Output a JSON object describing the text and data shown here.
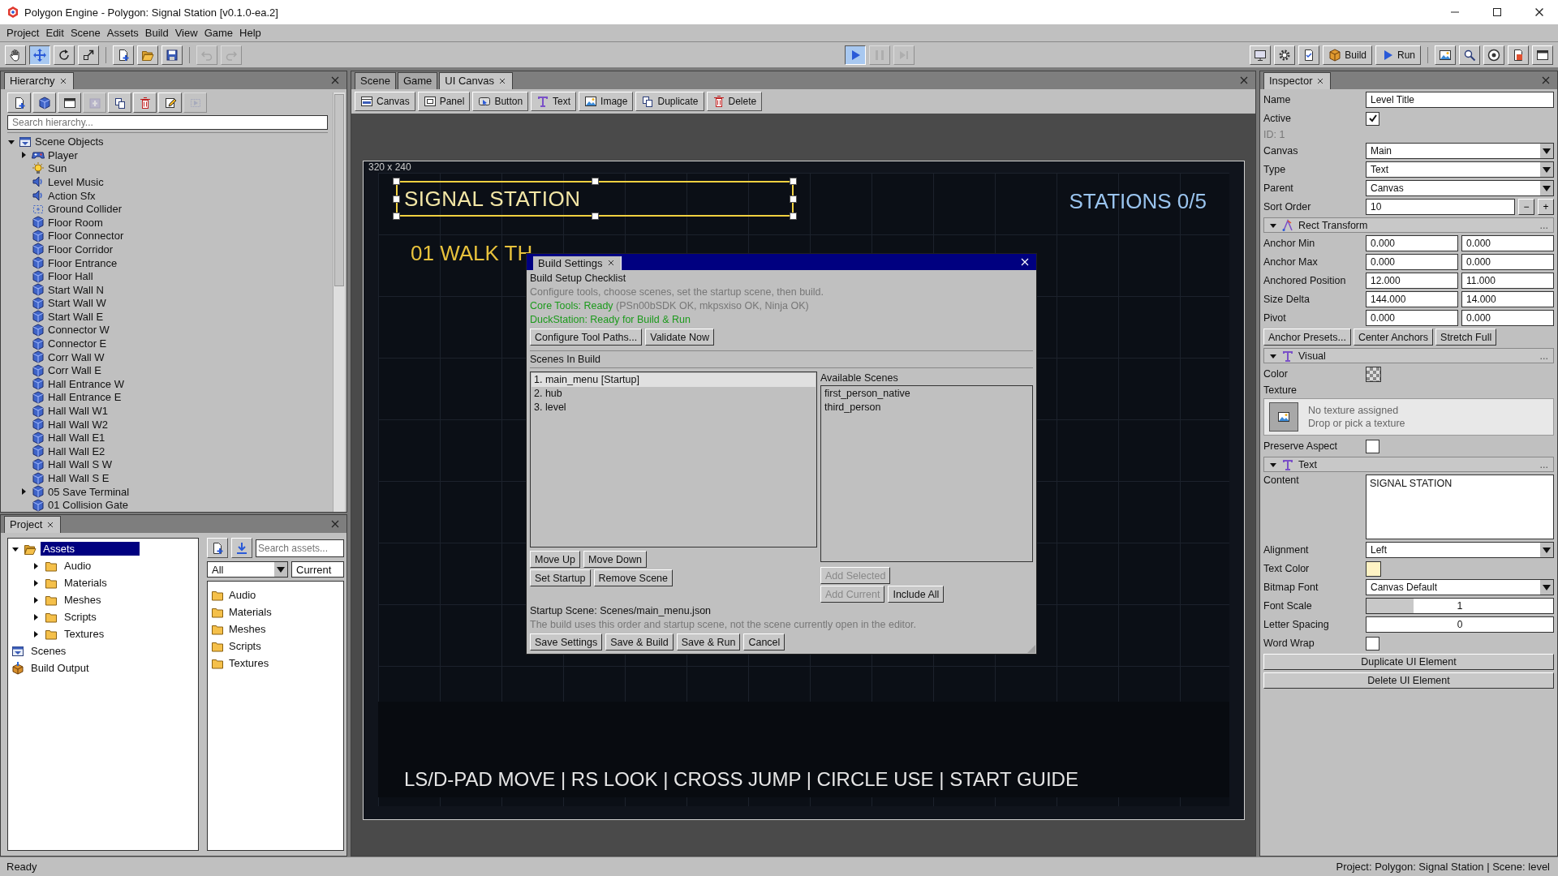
{
  "window": {
    "title": "Polygon Engine - Polygon: Signal Station [v0.1.0-ea.2]"
  },
  "menu": [
    "Project",
    "Edit",
    "Scene",
    "Assets",
    "Build",
    "View",
    "Game",
    "Help"
  ],
  "toolbar": {
    "left": [
      {
        "kind": "hand",
        "pressed": false,
        "disabled": false
      },
      {
        "kind": "move",
        "pressed": true,
        "disabled": false
      },
      {
        "kind": "rotate",
        "pressed": false,
        "disabled": false
      },
      {
        "kind": "scale",
        "pressed": false,
        "disabled": false
      },
      {
        "kind": "sep"
      },
      {
        "kind": "newdoc",
        "pressed": false,
        "disabled": false
      },
      {
        "kind": "open",
        "pressed": false,
        "disabled": false
      },
      {
        "kind": "save",
        "pressed": false,
        "disabled": false
      },
      {
        "kind": "sep"
      },
      {
        "kind": "undo",
        "pressed": false,
        "disabled": true
      },
      {
        "kind": "redo",
        "pressed": false,
        "disabled": true
      }
    ],
    "center": [
      {
        "kind": "play",
        "pressed": true,
        "disabled": false
      },
      {
        "kind": "pause",
        "pressed": false,
        "disabled": true
      },
      {
        "kind": "step",
        "pressed": false,
        "disabled": true
      }
    ],
    "right": [
      {
        "kind": "monitor",
        "pressed": false
      },
      {
        "kind": "gear",
        "pressed": false
      },
      {
        "kind": "checkdoc",
        "pressed": false
      },
      {
        "kind": "box",
        "label": "Build",
        "pressed": false
      },
      {
        "kind": "play",
        "label": "Run",
        "pressed": false
      },
      {
        "kind": "sep"
      },
      {
        "kind": "image",
        "pressed": false
      },
      {
        "kind": "search",
        "pressed": false
      },
      {
        "kind": "ring",
        "pressed": false
      },
      {
        "kind": "report",
        "pressed": false
      },
      {
        "kind": "window",
        "pressed": false
      }
    ]
  },
  "hierarchy": {
    "title": "Hierarchy",
    "tools": [
      {
        "kind": "newdoc",
        "disabled": false
      },
      {
        "kind": "cube",
        "disabled": false
      },
      {
        "kind": "window",
        "disabled": false
      },
      {
        "kind": "plusbox",
        "disabled": true
      },
      {
        "kind": "copy",
        "disabled": false
      },
      {
        "kind": "trash",
        "disabled": false
      },
      {
        "kind": "pencil",
        "disabled": false
      },
      {
        "kind": "prefab",
        "disabled": true
      }
    ],
    "search": {
      "placeholder": "Search hierarchy..."
    },
    "tree": [
      {
        "label": "Scene Objects",
        "kind": "scene",
        "expanded": true,
        "children": [
          {
            "label": "Player",
            "kind": "character",
            "expanded": false
          },
          {
            "label": "Sun",
            "kind": "light"
          },
          {
            "label": "Level Music",
            "kind": "audio"
          },
          {
            "label": "Action Sfx",
            "kind": "audio"
          },
          {
            "label": "Ground Collider",
            "kind": "collider"
          },
          {
            "label": "Floor Room",
            "kind": "cube"
          },
          {
            "label": "Floor Connector",
            "kind": "cube"
          },
          {
            "label": "Floor Corridor",
            "kind": "cube"
          },
          {
            "label": "Floor Entrance",
            "kind": "cube"
          },
          {
            "label": "Floor Hall",
            "kind": "cube"
          },
          {
            "label": "Start Wall N",
            "kind": "cube"
          },
          {
            "label": "Start Wall W",
            "kind": "cube"
          },
          {
            "label": "Start Wall E",
            "kind": "cube"
          },
          {
            "label": "Connector W",
            "kind": "cube"
          },
          {
            "label": "Connector E",
            "kind": "cube"
          },
          {
            "label": "Corr Wall W",
            "kind": "cube"
          },
          {
            "label": "Corr Wall E",
            "kind": "cube"
          },
          {
            "label": "Hall Entrance W",
            "kind": "cube"
          },
          {
            "label": "Hall Entrance E",
            "kind": "cube"
          },
          {
            "label": "Hall Wall W1",
            "kind": "cube"
          },
          {
            "label": "Hall Wall W2",
            "kind": "cube"
          },
          {
            "label": "Hall Wall E1",
            "kind": "cube"
          },
          {
            "label": "Hall Wall E2",
            "kind": "cube"
          },
          {
            "label": "Hall Wall S W",
            "kind": "cube"
          },
          {
            "label": "Hall Wall S E",
            "kind": "cube"
          },
          {
            "label": "05 Save Terminal",
            "kind": "cube",
            "expanded": false
          },
          {
            "label": "01 Collision Gate",
            "kind": "cube"
          }
        ]
      }
    ]
  },
  "project": {
    "title": "Project",
    "tree": [
      {
        "label": "Assets",
        "kind": "folder",
        "selected": true,
        "expanded": true,
        "children": [
          {
            "label": "Audio",
            "kind": "folder",
            "selected": false,
            "expanded": false
          },
          {
            "label": "Materials",
            "kind": "folder",
            "selected": false,
            "expanded": false
          },
          {
            "label": "Meshes",
            "kind": "folder",
            "selected": false,
            "expanded": false
          },
          {
            "label": "Scripts",
            "kind": "folder",
            "selected": false,
            "expanded": false
          },
          {
            "label": "Textures",
            "kind": "folder",
            "selected": false,
            "expanded": false
          }
        ]
      },
      {
        "label": "Scenes",
        "kind": "scene",
        "selected": false
      },
      {
        "label": "Build Output",
        "kind": "package",
        "selected": false
      }
    ],
    "search": {
      "placeholder": "Search assets..."
    },
    "filter": "All",
    "scope": "Current",
    "files": [
      "Audio",
      "Materials",
      "Meshes",
      "Scripts",
      "Textures"
    ]
  },
  "editor": {
    "tabs": [
      {
        "label": "Scene",
        "selected": false,
        "closable": false
      },
      {
        "label": "Game",
        "selected": false,
        "closable": false
      },
      {
        "label": "UI Canvas",
        "selected": true,
        "closable": true
      }
    ],
    "tools": [
      {
        "label": "Canvas",
        "kind": "canvas"
      },
      {
        "label": "Panel",
        "kind": "panel"
      },
      {
        "label": "Button",
        "kind": "button"
      },
      {
        "label": "Text",
        "kind": "type"
      },
      {
        "label": "Image",
        "kind": "image"
      },
      {
        "label": "Duplicate",
        "kind": "copy"
      },
      {
        "label": "Delete",
        "kind": "trash"
      }
    ],
    "canvas": {
      "size": "320 x 240",
      "elements": [
        {
          "text": "SIGNAL STATION",
          "kind": "title",
          "selected": true
        },
        {
          "text": "STATIONS 0/5",
          "kind": "counter",
          "selected": false
        },
        {
          "text": "01 WALK TH",
          "kind": "objective",
          "selected": false
        },
        {
          "text": "LS/D-PAD MOVE | RS LOOK | CROSS JUMP | CIRCLE USE | START GUIDE",
          "kind": "hints",
          "selected": false
        }
      ]
    }
  },
  "dialog": {
    "title": "Build Settings",
    "heading": "Build Setup Checklist",
    "intro": "Configure tools, choose scenes, set the startup scene, then build.",
    "core_tools": "Core Tools: Ready",
    "core_tools_detail": "(PSn00bSDK OK, mkpsxiso OK, Ninja OK)",
    "emulator": "DuckStation: Ready for Build & Run",
    "tool_buttons": [
      "Configure Tool Paths...",
      "Validate Now"
    ],
    "scenes_heading": "Scenes In Build",
    "scenes": [
      {
        "label": "1. main_menu  [Startup]",
        "selected": true
      },
      {
        "label": "2. hub",
        "selected": false
      },
      {
        "label": "3. level",
        "selected": false
      }
    ],
    "order_buttons": [
      [
        "Move Up",
        "Move Down"
      ],
      [
        "Set Startup",
        "Remove Scene"
      ]
    ],
    "available_heading": "Available Scenes",
    "available": [
      "first_person_native",
      "third_person"
    ],
    "available_buttons": [
      [
        {
          "label": "Add Selected",
          "disabled": true
        }
      ],
      [
        {
          "label": "Add Current",
          "disabled": true
        },
        {
          "label": "Include All",
          "disabled": false
        }
      ]
    ],
    "startup": "Startup Scene: Scenes/main_menu.json",
    "note": "The build uses this order and startup scene, not the scene currently open in the editor.",
    "footer_buttons": [
      "Save Settings",
      "Save & Build",
      "Save & Run",
      "Cancel"
    ]
  },
  "inspector": {
    "title": "Inspector",
    "rows": [
      {
        "kind": "text",
        "label": "Name",
        "value": "Level Title"
      },
      {
        "kind": "check",
        "label": "Active",
        "checked": true
      },
      {
        "kind": "note",
        "label": "ID: 1"
      },
      {
        "kind": "select",
        "label": "Canvas",
        "value": "Main"
      },
      {
        "kind": "select",
        "label": "Type",
        "value": "Text"
      },
      {
        "kind": "select",
        "label": "Parent",
        "value": "Canvas"
      },
      {
        "kind": "stepper",
        "label": "Sort Order",
        "value": "10",
        "minus": "−",
        "plus": "+"
      },
      {
        "kind": "section",
        "label": "Rect Transform",
        "more": "...",
        "expanded": true
      },
      {
        "kind": "pair",
        "label": "Anchor Min",
        "values": [
          "0.000",
          "0.000"
        ]
      },
      {
        "kind": "pair",
        "label": "Anchor Max",
        "values": [
          "0.000",
          "0.000"
        ]
      },
      {
        "kind": "pair",
        "label": "Anchored Position",
        "values": [
          "12.000",
          "11.000"
        ]
      },
      {
        "kind": "pair",
        "label": "Size Delta",
        "values": [
          "144.000",
          "14.000"
        ]
      },
      {
        "kind": "pair",
        "label": "Pivot",
        "values": [
          "0.000",
          "0.000"
        ]
      },
      {
        "kind": "buttons",
        "buttons": [
          "Anchor Presets...",
          "Center Anchors",
          "Stretch Full"
        ]
      },
      {
        "kind": "section",
        "label": "Visual",
        "more": "...",
        "expanded": true
      },
      {
        "kind": "checker",
        "label": "Color"
      },
      {
        "kind": "label",
        "label": "Texture"
      },
      {
        "kind": "texture",
        "lines": [
          "No texture assigned",
          "Drop or pick a texture"
        ]
      },
      {
        "kind": "check",
        "label": "Preserve Aspect",
        "checked": false
      },
      {
        "kind": "section",
        "label": "Text",
        "more": "...",
        "expanded": true
      },
      {
        "kind": "textarea",
        "label": "Content",
        "value": "SIGNAL STATION"
      },
      {
        "kind": "select",
        "label": "Alignment",
        "value": "Left"
      },
      {
        "kind": "swatch",
        "label": "Text Color",
        "color": "#fff3c4"
      },
      {
        "kind": "select",
        "label": "Bitmap Font",
        "value": "Canvas Default"
      },
      {
        "kind": "slider",
        "label": "Font Scale",
        "value": "1",
        "level": 0.25
      },
      {
        "kind": "number",
        "label": "Letter Spacing",
        "value": "0"
      },
      {
        "kind": "check",
        "label": "Word Wrap",
        "checked": false
      },
      {
        "kind": "wide",
        "label": "Duplicate UI Element"
      },
      {
        "kind": "wide",
        "label": "Delete UI Element"
      }
    ]
  },
  "status_bar": {
    "left": "Ready",
    "right": "Project: Polygon: Signal Station | Scene: level"
  }
}
